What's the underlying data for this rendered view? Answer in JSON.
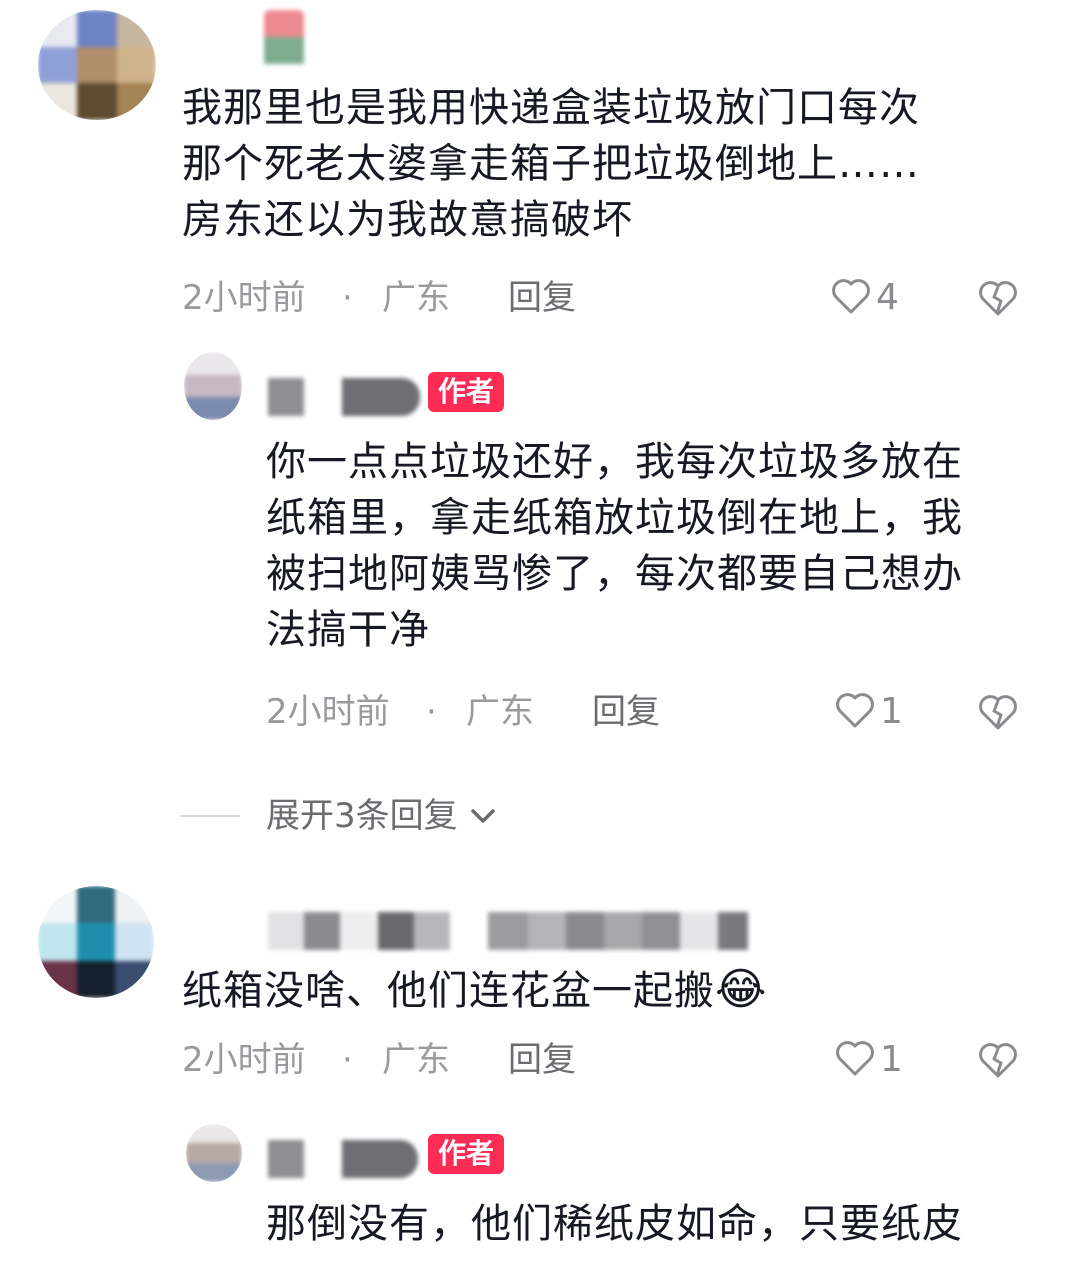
{
  "comments": [
    {
      "text": "我那里也是我用快递盒装垃圾放门口每次\n那个死老太婆拿走箱子把垃圾倒地上……\n房东还以为我故意搞破坏",
      "time": "2小时前",
      "sep": "·",
      "location": "广东",
      "reply_label": "回复",
      "likes": "4",
      "replies": [
        {
          "badge": "作者",
          "text": "你一点点垃圾还好，我每次垃圾多放在\n纸箱里，拿走纸箱放垃圾倒在地上，我\n被扫地阿姨骂惨了，每次都要自己想办\n法搞干净",
          "time": "2小时前",
          "sep": "·",
          "location": "广东",
          "reply_label": "回复",
          "likes": "1"
        }
      ],
      "expand_label": "展开3条回复"
    },
    {
      "text": "纸箱没啥、他们连花盆一起搬",
      "emoji": "😂",
      "time": "2小时前",
      "sep": "·",
      "location": "广东",
      "reply_label": "回复",
      "likes": "1",
      "replies": [
        {
          "badge": "作者",
          "text": "那倒没有，他们稀纸皮如命，只要纸皮"
        }
      ]
    }
  ],
  "icons": {
    "like": "heart-outline-icon",
    "dislike": "broken-heart-icon",
    "expand": "chevron-down-icon"
  },
  "colors": {
    "badge": "#fe2c55",
    "meta": "#9a9a9e",
    "text": "#161823"
  }
}
